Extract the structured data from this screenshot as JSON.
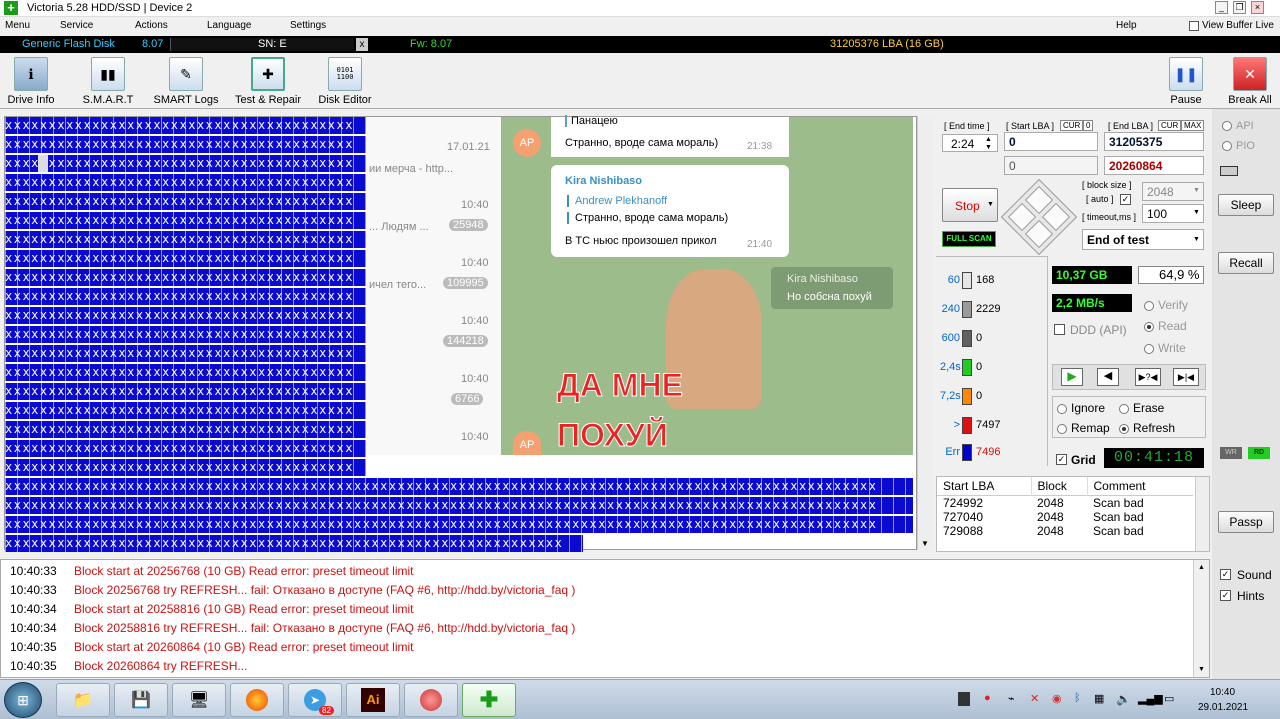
{
  "titlebar": {
    "title": "Victoria 5.28 HDD/SSD | Device 2",
    "icons": [
      "minimize-icon",
      "restore-icon",
      "close-icon"
    ]
  },
  "menu": {
    "items": [
      "Menu",
      "Service",
      "Actions",
      "Language",
      "Settings"
    ],
    "help": "Help",
    "buffer": "View Buffer Live"
  },
  "device": {
    "name": "Generic Flash Disk",
    "version": "8.07",
    "sn": "SN: E",
    "sn_clear": "x",
    "fw": "Fw: 8.07",
    "lba": "31205376 LBA (16 GB)"
  },
  "toolbar": {
    "drive_info": "Drive Info",
    "smart": "S.M.A.R.T",
    "smart_logs": "SMART Logs",
    "test_repair": "Test & Repair",
    "disk_editor": "Disk Editor",
    "pause": "Pause",
    "break_all": "Break All"
  },
  "chat": {
    "date": "17.01.21",
    "item1": "ии мерча - http...",
    "t1": "10:40",
    "item2": "... Людям ...",
    "b2": "25948",
    "t2": "10:40",
    "item3": "ичел тего...",
    "b3": "109995",
    "t3": "10:40",
    "b4": "144218",
    "t4": "10:40",
    "b5": "6766",
    "t5": "10:40",
    "avatar": "AP",
    "msg0": "Панацею",
    "msg1": "Странно, вроде сама мораль)",
    "msg1time": "21:38",
    "sender": "Kira Nishibaso",
    "quote_name": "Andrew Plekhanoff",
    "quote_text": "Странно, вроде сама мораль)",
    "msg2": "В ТС ньюс произошел прикол",
    "msg2time": "21:40",
    "kira2": "Kira Nishibaso",
    "kira2text": "Но собсна похуй",
    "meme1": "ДА МНЕ",
    "meme2": "ПОХУЙ"
  },
  "scan": {
    "end_time_lbl": "[ End time ]",
    "start_lba_lbl": "[ Start LBA ]",
    "cur": "CUR",
    "zero": "0",
    "end_lba_lbl": "[ End LBA ]",
    "cur2": "CUR",
    "max": "MAX",
    "time": "2:24",
    "start_lba": "0",
    "end_lba": "31205375",
    "cur_lba": "0",
    "cur_end": "20260864",
    "stop": "Stop",
    "full_scan": "FULL SCAN",
    "block_size_lbl": "[ block size ]",
    "auto_lbl": "[ auto ]",
    "block_size": "2048",
    "timeout_lbl": "[ timeout,ms ]",
    "timeout": "100",
    "end_action": "End of test"
  },
  "stats": {
    "rows": [
      {
        "lbl": "60",
        "v": "168",
        "c": "#e6e6e6"
      },
      {
        "lbl": "240",
        "v": "2229",
        "c": "#9a9a9a"
      },
      {
        "lbl": "600",
        "v": "0",
        "c": "#606060"
      },
      {
        "lbl": "2,4s",
        "v": "0",
        "c": "#22cc22"
      },
      {
        "lbl": "7,2s",
        "v": "0",
        "c": "#ff8800"
      },
      {
        "lbl": ">",
        "v": "7497",
        "c": "#dd1111"
      },
      {
        "lbl": "Err",
        "v": "7496",
        "c": "#0000cc"
      }
    ],
    "size": "10,37 GB",
    "pct": "64,9  %",
    "speed": "2,2 MB/s",
    "ddd": "DDD (API)",
    "verify": "Verify",
    "read": "Read",
    "write": "Write",
    "ignore": "Ignore",
    "erase": "Erase",
    "remap": "Remap",
    "refresh": "Refresh",
    "grid": "Grid",
    "timer": "00:41:18"
  },
  "table": {
    "headers": [
      "Start LBA",
      "Block",
      "Comment"
    ],
    "rows": [
      [
        "724992",
        "2048",
        "Scan bad"
      ],
      [
        "727040",
        "2048",
        "Scan bad"
      ],
      [
        "729088",
        "2048",
        "Scan bad"
      ]
    ]
  },
  "log": [
    {
      "t": "10:40:33",
      "m": "Block start at 20256768 (10 GB) Read error: preset timeout limit"
    },
    {
      "t": "10:40:33",
      "m": "Block 20256768 try REFRESH... fail: Отказано в доступе (FAQ #6, http://hdd.by/victoria_faq )"
    },
    {
      "t": "10:40:34",
      "m": "Block start at 20258816 (10 GB) Read error: preset timeout limit"
    },
    {
      "t": "10:40:34",
      "m": "Block 20258816 try REFRESH... fail: Отказано в доступе (FAQ #6, http://hdd.by/victoria_faq )"
    },
    {
      "t": "10:40:35",
      "m": "Block start at 20260864 (10 GB) Read error: preset timeout limit"
    },
    {
      "t": "10:40:35",
      "m": "Block 20260864 try REFRESH..."
    }
  ],
  "side": {
    "api": "API",
    "pio": "PIO",
    "sleep": "Sleep",
    "recall": "Recall",
    "wr": "WR",
    "rd": "RD",
    "passp": "Passp",
    "sound": "Sound",
    "hints": "Hints"
  },
  "tray": {
    "time": "10:40",
    "date": "29.01.2021",
    "badge": "82",
    "ai": "Ai"
  }
}
